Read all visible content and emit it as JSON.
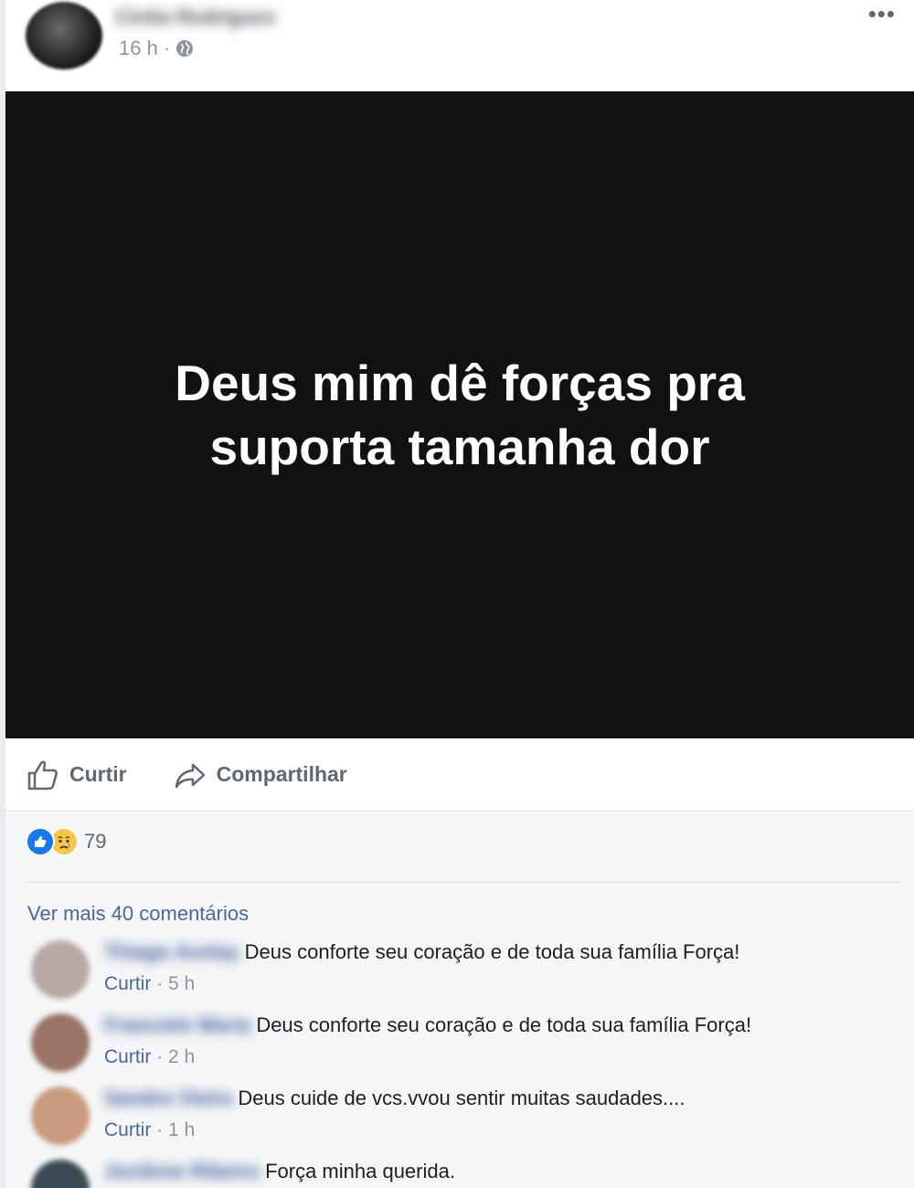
{
  "post": {
    "author_name": "Cíntia Rodrigues",
    "time": "16 h",
    "separator": "·",
    "more_label": "•••",
    "image_text_line1": "Deus mim dê forças pra",
    "image_text_line2": "suporta tamanha dor"
  },
  "actions": {
    "like_label": "Curtir",
    "share_label": "Compartilhar"
  },
  "reactions": {
    "count": "79",
    "types": [
      "like",
      "sad"
    ]
  },
  "comments": {
    "view_more_label": "Ver mais 40 comentários",
    "items": [
      {
        "name": "Thiago Avelay",
        "text": "Deus conforte seu coração e de toda sua família Força!",
        "like_label": "Curtir",
        "time": "5 h",
        "avatar_color": "#b8a9a4"
      },
      {
        "name": "Franciele Maria",
        "text": "Deus conforte seu coração e de toda sua família Força!",
        "like_label": "Curtir",
        "time": "2 h",
        "avatar_color": "#9a7466"
      },
      {
        "name": "Sandra Vieira",
        "text": "Deus cuide de vcs.vvou sentir muitas saudades....",
        "like_label": "Curtir",
        "time": "1 h",
        "avatar_color": "#c99a7e"
      },
      {
        "name": "Jocilene Ribeiro",
        "text": "Força minha querida.",
        "like_label": "",
        "time": "",
        "avatar_color": "#3b4a52"
      }
    ]
  },
  "colors": {
    "accent_link": "#4b67a1",
    "like_blue": "#1877f2",
    "image_bg": "#111111"
  }
}
